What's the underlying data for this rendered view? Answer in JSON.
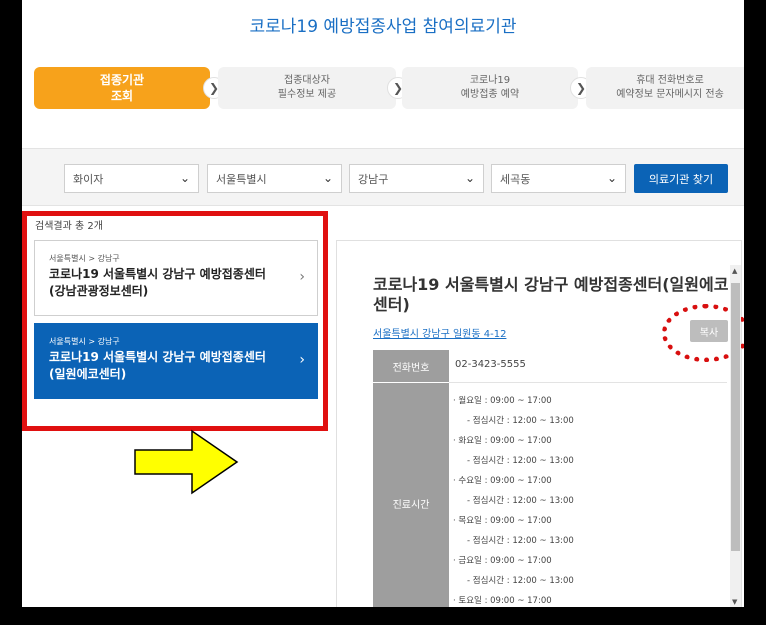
{
  "title": "코로나19 예방접종사업 참여의료기관",
  "steps": [
    {
      "line1": "접종기관",
      "line2": "조회"
    },
    {
      "line1": "접종대상자",
      "line2": "필수정보 제공"
    },
    {
      "line1": "코로나19",
      "line2": "예방접종 예약"
    },
    {
      "line1": "휴대 전화번호로",
      "line2": "예약정보 문자메시지 전송"
    }
  ],
  "filters": {
    "vaccine": "화이자",
    "city": "서울특별시",
    "district": "강남구",
    "dong": "세곡동",
    "find_button": "의료기관 찾기"
  },
  "result_count": "검색결과 총 2개",
  "results": [
    {
      "crumb": "서울특별시 > 강남구",
      "name_line1": "코로나19 서울특별시 강남구 예방접종센터",
      "name_line2": "(강남관광정보센터)"
    },
    {
      "crumb": "서울특별시 > 강남구",
      "name_line1": "코로나19 서울특별시 강남구 예방접종센터",
      "name_line2": "(일원에코센터)"
    }
  ],
  "detail": {
    "name": "코로나19 서울특별시 강남구 예방접종센터(일원에코센터)",
    "address": "서울특별시 강남구 일원동 4-12",
    "copy_button": "복사",
    "phone_label": "전화번호",
    "phone": "02-3423-5555",
    "hours_label": "진료시간",
    "hours": [
      {
        "day": "· 월요일 : 09:00 ~ 17:00",
        "lunch": "- 점심시간 : 12:00 ~ 13:00"
      },
      {
        "day": "· 화요일 : 09:00 ~ 17:00",
        "lunch": "- 점심시간 : 12:00 ~ 13:00"
      },
      {
        "day": "· 수요일 : 09:00 ~ 17:00",
        "lunch": "- 점심시간 : 12:00 ~ 13:00"
      },
      {
        "day": "· 목요일 : 09:00 ~ 17:00",
        "lunch": "- 점심시간 : 12:00 ~ 13:00"
      },
      {
        "day": "· 금요일 : 09:00 ~ 17:00",
        "lunch": "- 점심시간 : 12:00 ~ 13:00"
      },
      {
        "day": "· 토요일 : 09:00 ~ 17:00",
        "lunch": ""
      }
    ]
  },
  "icons": {
    "chevron": "chevron-right-icon",
    "dropdown": "chevron-down-icon",
    "pointer": "arrow-right-icon"
  },
  "colors": {
    "accent": "#0b63b6",
    "step_active": "#f7a21b",
    "highlight": "#e01010",
    "arrow": "#ffff00"
  }
}
